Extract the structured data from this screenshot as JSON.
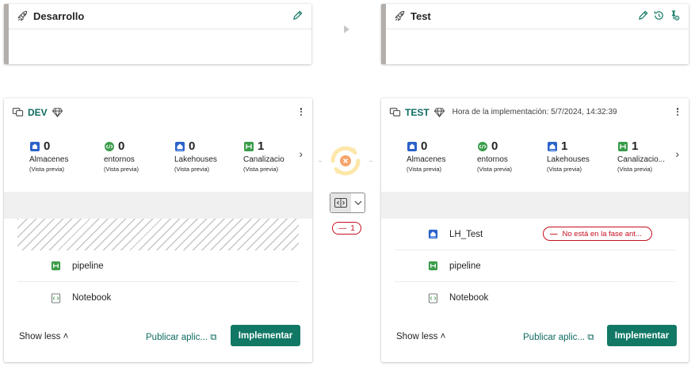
{
  "stages": {
    "dev": {
      "title": "Desarrollo"
    },
    "test": {
      "title": "Test"
    }
  },
  "dev_panel": {
    "workspace": "DEV",
    "counts": [
      {
        "icon": "warehouse-icon",
        "value": "0",
        "label": "Almacenes",
        "sub": "(Vista previa)"
      },
      {
        "icon": "environment-icon",
        "value": "0",
        "label": "entornos",
        "sub": "(Vista previa)"
      },
      {
        "icon": "lakehouse-icon",
        "value": "0",
        "label": "Lakehouses",
        "sub": "(Vista previa)"
      },
      {
        "icon": "pipeline-icon",
        "value": "1",
        "label": "Canalizacio",
        "sub": "(Vista previa)"
      }
    ],
    "items": [
      {
        "icon": "pipeline-icon",
        "name": "pipeline"
      },
      {
        "icon": "notebook-icon",
        "name": "Notebook"
      }
    ],
    "show_less": "Show less",
    "publish": "Publicar aplic...",
    "deploy": "Implementar"
  },
  "test_panel": {
    "workspace": "TEST",
    "deploy_time": "Hora de la implementación: 5/7/2024, 14:32:39",
    "counts": [
      {
        "icon": "warehouse-icon",
        "value": "0",
        "label": "Almacenes",
        "sub": "(Vista previa)"
      },
      {
        "icon": "environment-icon",
        "value": "0",
        "label": "entornos",
        "sub": "(Vista previa)"
      },
      {
        "icon": "lakehouse-icon",
        "value": "1",
        "label": "Lakehouses",
        "sub": "(Vista previa)"
      },
      {
        "icon": "pipeline-icon",
        "value": "1",
        "label": "Canalizacio...",
        "sub": "(Vista previa)"
      }
    ],
    "items": [
      {
        "icon": "lakehouse-icon",
        "name": "LH_Test",
        "badge": "No está en la fase ant..."
      },
      {
        "icon": "pipeline-icon",
        "name": "pipeline"
      },
      {
        "icon": "notebook-icon",
        "name": "Notebook"
      }
    ],
    "show_less": "Show less",
    "publish": "Publicar aplic...",
    "deploy": "Implementar"
  },
  "compare": {
    "diff_symbol": "—",
    "diff_count": "1"
  },
  "colors": {
    "accent": "#117865",
    "link": "#0f6b62",
    "error": "#c50f1f",
    "sync": "#fde7a9",
    "sync_error": "#f5a46a"
  }
}
